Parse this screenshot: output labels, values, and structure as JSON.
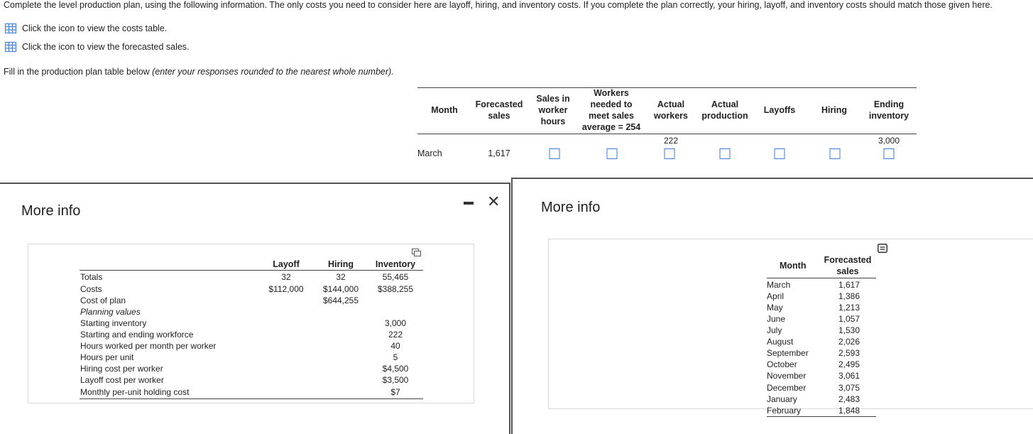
{
  "instructions": "Complete the level production plan, using the following information. The only costs you need to consider here are layoff, hiring, and inventory costs. If you complete the plan correctly, your hiring, layoff, and inventory costs should match those given here.",
  "links": {
    "costs": "Click the icon to view the costs table.",
    "sales": "Click the icon to view the forecasted sales."
  },
  "fill_prompt": "Fill in the production plan table below",
  "fill_prompt_note": "(enter your responses rounded to the nearest whole number).",
  "plan_table": {
    "headers": {
      "month": "Month",
      "forecasted": [
        "Forecasted",
        "sales"
      ],
      "sales_hours": [
        "Sales in",
        "worker",
        "hours"
      ],
      "workers_needed": [
        "Workers",
        "needed to",
        "meet sales",
        "average = 254"
      ],
      "actual_workers": [
        "Actual",
        "workers"
      ],
      "actual_production": [
        "Actual",
        "production"
      ],
      "layoffs": "Layoffs",
      "hiring": "Hiring",
      "ending_inventory": [
        "Ending",
        "inventory"
      ]
    },
    "initial_workers": "222",
    "initial_inventory": "3,000",
    "row": {
      "month": "March",
      "forecasted": "1,617"
    }
  },
  "costs_dialog": {
    "title": "More info",
    "columns": [
      "Layoff",
      "Hiring",
      "Inventory"
    ],
    "totals": {
      "label": "Totals",
      "layoff": "32",
      "hiring": "32",
      "inventory": "55,465"
    },
    "costs": {
      "label": "Costs",
      "layoff": "$112,000",
      "hiring": "$144,000",
      "inventory": "$388,255"
    },
    "cost_of_plan": {
      "label": "Cost of plan",
      "value": "$644,255"
    },
    "planning_values_label": "Planning values",
    "planning": [
      {
        "label": "Starting inventory",
        "value": "3,000"
      },
      {
        "label": "Starting and ending workforce",
        "value": "222"
      },
      {
        "label": "Hours worked per month per worker",
        "value": "40"
      },
      {
        "label": "Hours per unit",
        "value": "5"
      },
      {
        "label": "Hiring cost per worker",
        "value": "$4,500"
      },
      {
        "label": "Layoff cost per worker",
        "value": "$3,500"
      },
      {
        "label": "Monthly per-unit holding cost",
        "value": "$7"
      }
    ]
  },
  "sales_dialog": {
    "title": "More info",
    "header_month": "Month",
    "header_sales": [
      "Forecasted",
      "sales"
    ],
    "rows": [
      {
        "month": "March",
        "sales": "1,617"
      },
      {
        "month": "April",
        "sales": "1,386"
      },
      {
        "month": "May",
        "sales": "1,213"
      },
      {
        "month": "June",
        "sales": "1,057"
      },
      {
        "month": "July",
        "sales": "1,530"
      },
      {
        "month": "August",
        "sales": "2,026"
      },
      {
        "month": "September",
        "sales": "2,593"
      },
      {
        "month": "October",
        "sales": "2,495"
      },
      {
        "month": "November",
        "sales": "3,061"
      },
      {
        "month": "December",
        "sales": "3,075"
      },
      {
        "month": "January",
        "sales": "2,483"
      },
      {
        "month": "February",
        "sales": "1,848"
      }
    ]
  },
  "colors": {
    "accent": "#3b7dd8",
    "border": "#444444"
  }
}
